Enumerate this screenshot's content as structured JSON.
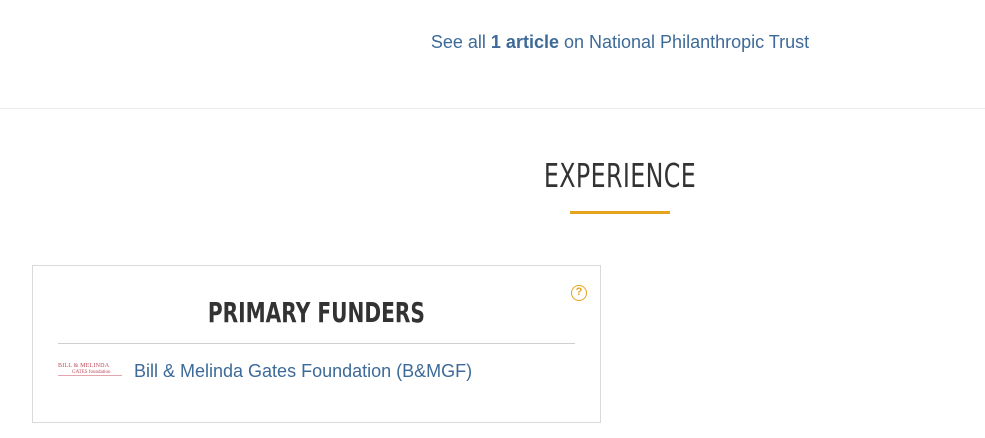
{
  "articles_link": {
    "prefix": "See all",
    "count_text": "1 article",
    "suffix": "on National Philanthropic Trust"
  },
  "experience": {
    "title": "EXPERIENCE",
    "accent_color": "#e8a31e"
  },
  "primary_funders": {
    "title": "PRIMARY FUNDERS",
    "help_icon": "question-circle-icon",
    "help_glyph": "?",
    "items": [
      {
        "logo_line1": "BILL & MELINDA",
        "logo_line2": "GATES foundation",
        "name": "Bill & Melinda Gates Foundation (B&MGF)"
      }
    ]
  },
  "colors": {
    "link": "#3d6a98",
    "accent": "#e8a31e",
    "logo": "#c0485a"
  }
}
